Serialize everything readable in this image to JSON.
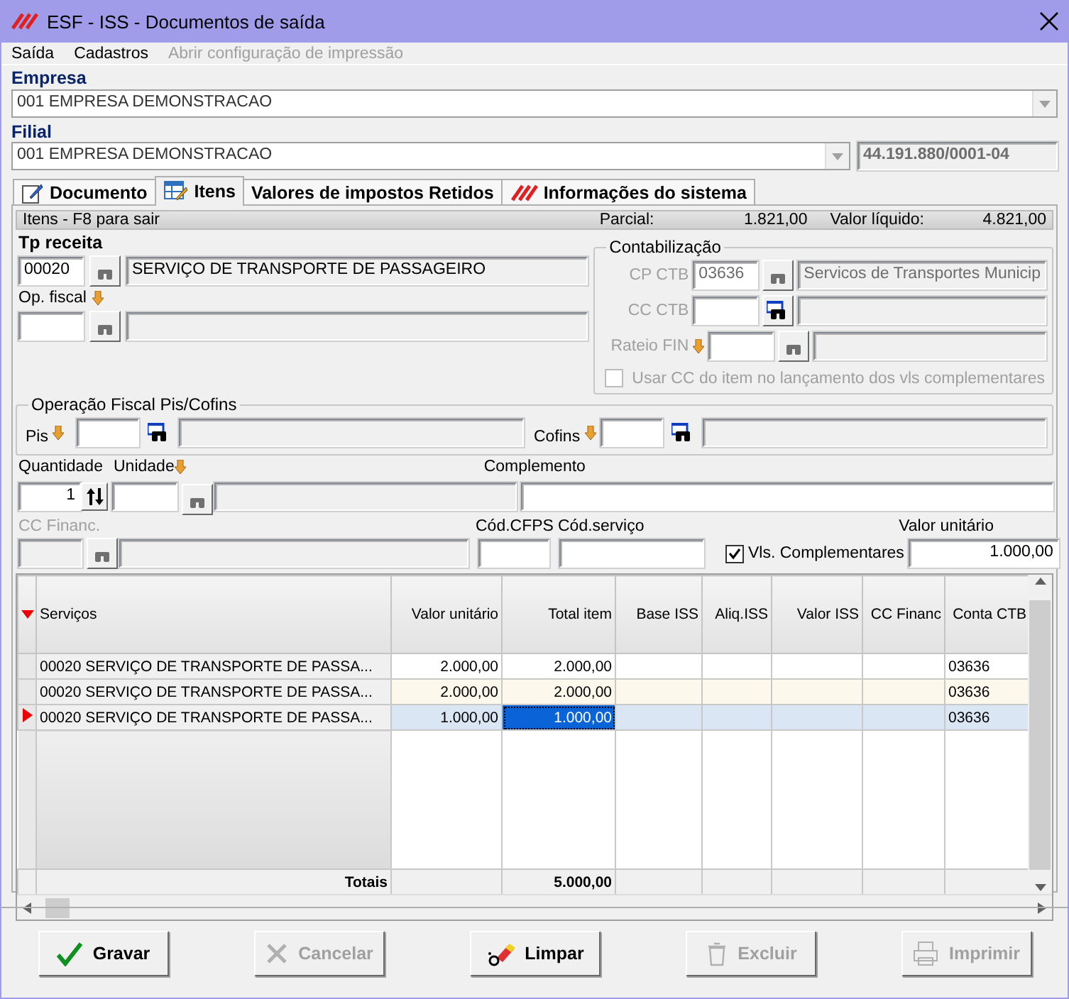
{
  "window": {
    "title": "ESF - ISS - Documentos de saída"
  },
  "menu": [
    {
      "label": "Saída",
      "disabled": false
    },
    {
      "label": "Cadastros",
      "disabled": false
    },
    {
      "label": "Abrir configuração de impressão",
      "disabled": true
    }
  ],
  "empresa": {
    "label": "Empresa",
    "value": "001 EMPRESA DEMONSTRACAO"
  },
  "filial": {
    "label": "Filial",
    "value": "001 EMPRESA DEMONSTRACAO",
    "cnpj": "44.191.880/0001-04"
  },
  "tabs": [
    {
      "label": "Documento",
      "selected": false,
      "kind": "edit"
    },
    {
      "label": "Itens",
      "selected": true,
      "kind": "table"
    },
    {
      "label": "Valores de impostos Retidos",
      "selected": false,
      "kind": "none"
    },
    {
      "label": "Informações do sistema",
      "selected": false,
      "kind": "logo"
    }
  ],
  "status": {
    "hint": "Itens - F8 para sair",
    "parcial_label": "Parcial:",
    "parcial": "1.821,00",
    "liquido_label": "Valor líquido:",
    "liquido": "4.821,00"
  },
  "tp_receita": {
    "label": "Tp receita",
    "code": "00020",
    "description": "SERVIÇO DE TRANSPORTE DE PASSAGEIRO"
  },
  "op_fiscal": {
    "label": "Op. fiscal",
    "filter_arrow": true
  },
  "contabilizacao": {
    "title": "Contabilização",
    "disabled": true,
    "rows": [
      {
        "label": "CP CTB",
        "code": "03636",
        "description": "Servicos de Transportes Municip",
        "lookup_enabled": false,
        "filter_arrow": false
      },
      {
        "label": "CC CTB",
        "lookup_enabled": true,
        "filter_arrow": false
      },
      {
        "label": "Rateio FIN",
        "lookup_enabled": false,
        "filter_arrow": true
      }
    ],
    "checkbox": {
      "label": "Usar CC do item no lançamento dos vls complementares",
      "checked": false
    }
  },
  "pis_cofins": {
    "title": "Operação Fiscal Pis/Cofins",
    "pis": {
      "label": "Pis",
      "filter_arrow": true,
      "lookup_enabled": true
    },
    "cofins": {
      "label": "Cofins",
      "filter_arrow": true,
      "lookup_enabled": true
    }
  },
  "quantidade": {
    "label": "Quantidade",
    "value": "1"
  },
  "unidade": {
    "label": "Unidade",
    "filter_arrow": true
  },
  "complemento": {
    "label": "Complemento"
  },
  "cc_financ": {
    "label": "CC Financ.",
    "disabled": true
  },
  "cod_cfps": {
    "label": "Cód.CFPS"
  },
  "cod_servico": {
    "label": "Cód.serviço"
  },
  "vls_complementares": {
    "label": "Vls. Complementares",
    "checked": true
  },
  "valor_unitario": {
    "label": "Valor unitário",
    "value": "1.000,00"
  },
  "grid": {
    "columns": [
      "Serviços",
      "Valor unitário",
      "Total item",
      "Base ISS",
      "Aliq.ISS",
      "Valor ISS",
      "CC Financ",
      "Conta CTB"
    ],
    "rows": [
      {
        "servico": "00020 SERVIÇO DE TRANSPORTE DE PASSA...",
        "valor_unitario": "2.000,00",
        "total_item": "2.000,00",
        "conta_ctb": "03636",
        "selected": false
      },
      {
        "servico": "00020 SERVIÇO DE TRANSPORTE DE PASSA...",
        "valor_unitario": "2.000,00",
        "total_item": "2.000,00",
        "conta_ctb": "03636",
        "selected": false
      },
      {
        "servico": "00020 SERVIÇO DE TRANSPORTE DE PASSA...",
        "valor_unitario": "1.000,00",
        "total_item": "1.000,00",
        "conta_ctb": "03636",
        "selected": true
      }
    ],
    "totals": {
      "label": "Totais",
      "total_item": "5.000,00"
    }
  },
  "buttons": [
    {
      "label": "Gravar",
      "kind": "save",
      "disabled": false
    },
    {
      "label": "Cancelar",
      "kind": "cancel",
      "disabled": true
    },
    {
      "label": "Limpar",
      "kind": "clear",
      "disabled": false
    },
    {
      "label": "Excluir",
      "kind": "delete",
      "disabled": true
    },
    {
      "label": "Imprimir",
      "kind": "print",
      "disabled": true
    }
  ]
}
